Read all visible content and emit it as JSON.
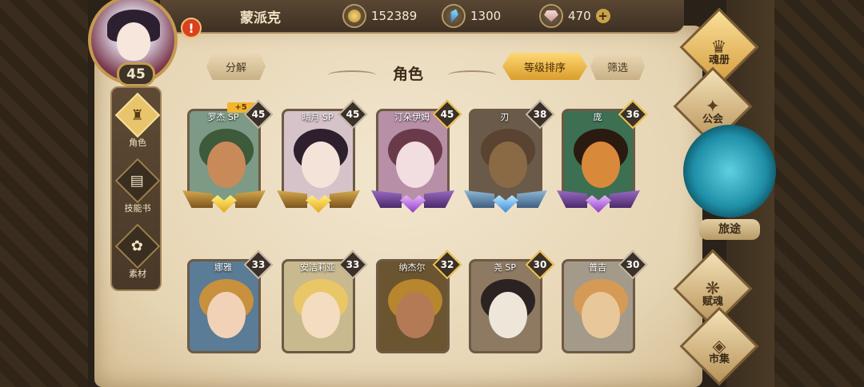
{
  "player": {
    "name": "蒙派克",
    "level": "45",
    "alert": "!"
  },
  "resources": {
    "gold": "152389",
    "crystal": "1300",
    "gem": "470",
    "add": "+"
  },
  "header": {
    "title": "角色",
    "decompose": "分解",
    "sort": "等级排序",
    "filter": "筛选"
  },
  "left_nav": [
    {
      "label": "角色",
      "icon": "helmet-icon",
      "active": true
    },
    {
      "label": "技能书",
      "icon": "skill-book-icon",
      "active": false
    },
    {
      "label": "素材",
      "icon": "material-icon",
      "active": false
    }
  ],
  "right_nav": {
    "soul_book": "魂册",
    "guild": "公会",
    "journey": "旅途",
    "endow": "赋魂",
    "market": "市集"
  },
  "heroes": [
    {
      "name": "罗杰 SP",
      "level": "45",
      "bonus": "+5",
      "rarity": "gold",
      "skin": "#c98a5a",
      "bg": "#7c9a86",
      "hair": "#3d5a3a"
    },
    {
      "name": "晴月 SP",
      "level": "45",
      "rarity": "gold",
      "skin": "#f4e3d8",
      "bg": "#d6c3c9",
      "hair": "#2e1f2e"
    },
    {
      "name": "汀朵伊姆",
      "level": "45",
      "rarity": "purple",
      "gold_badge": true,
      "skin": "#f2dde0",
      "bg": "#b78fa6",
      "hair": "#6b3a4a"
    },
    {
      "name": "刃",
      "level": "38",
      "rarity": "blue",
      "skin": "#8a6a45",
      "bg": "#6a5a4a",
      "hair": "#5a4330"
    },
    {
      "name": "庞",
      "level": "36",
      "rarity": "purple",
      "gold_badge": true,
      "skin": "#d9893a",
      "bg": "#3d6f52",
      "hair": "#2a1a10"
    },
    {
      "name": "娜雅",
      "level": "33",
      "skin": "#f2d2b6",
      "bg": "#5a7c96",
      "hair": "#c7913e"
    },
    {
      "name": "安洁莉亚",
      "level": "33",
      "skin": "#f4dcc0",
      "bg": "#c9b98e",
      "hair": "#e9c766"
    },
    {
      "name": "纳杰尔",
      "level": "32",
      "gold_badge": true,
      "skin": "#b47a55",
      "bg": "#6a5530",
      "hair": "#b7862e"
    },
    {
      "name": "尧 SP",
      "level": "30",
      "gold_badge": true,
      "skin": "#efe6da",
      "bg": "#8e7a62",
      "hair": "#2a2322"
    },
    {
      "name": "普吉",
      "level": "30",
      "skin": "#e8c79a",
      "bg": "#a39a8a",
      "hair": "#d59a56"
    }
  ]
}
